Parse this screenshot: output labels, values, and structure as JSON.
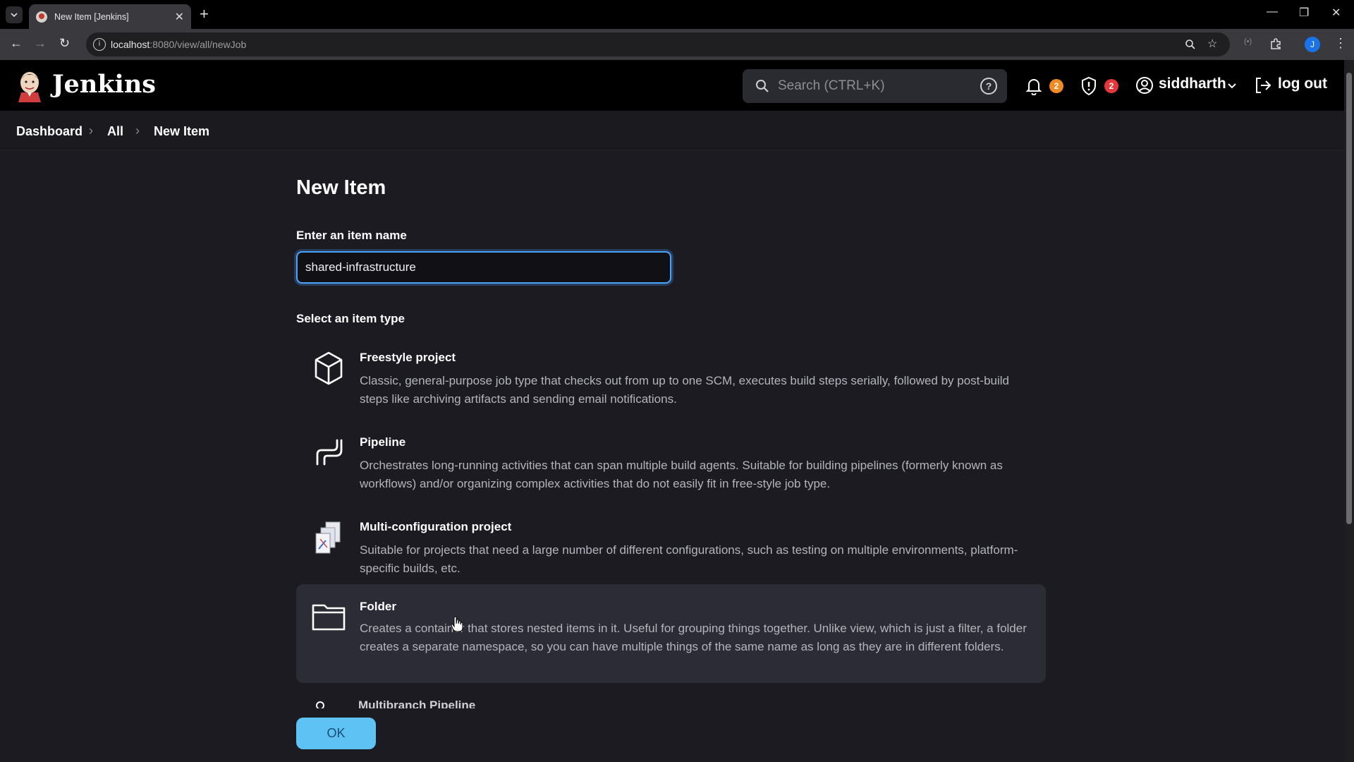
{
  "browser": {
    "tab_title": "New Item [Jenkins]",
    "url_host": "localhost",
    "url_rest": ":8080/view/all/newJob",
    "profile_initial": "J"
  },
  "header": {
    "brand": "Jenkins",
    "search_placeholder": "Search (CTRL+K)",
    "notifications_count": "2",
    "security_count": "2",
    "user": "siddharth",
    "logout": "log out",
    "colors": {
      "notify_badge": "#f08a24",
      "security_badge": "#e5383b"
    }
  },
  "breadcrumb": [
    "Dashboard",
    "All",
    "New Item"
  ],
  "page": {
    "title": "New Item",
    "name_label": "Enter an item name",
    "name_value": "shared-infrastructure",
    "type_label": "Select an item type",
    "ok_label": "OK"
  },
  "item_types": [
    {
      "name": "Freestyle project",
      "icon": "cube-icon",
      "description": "Classic, general-purpose job type that checks out from up to one SCM, executes build steps serially, followed by post-build steps like archiving artifacts and sending email notifications."
    },
    {
      "name": "Pipeline",
      "icon": "pipeline-icon",
      "description": "Orchestrates long-running activities that can span multiple build agents. Suitable for building pipelines (formerly known as workflows) and/or organizing complex activities that do not easily fit in free-style job type."
    },
    {
      "name": "Multi-configuration project",
      "icon": "documents-icon",
      "description": "Suitable for projects that need a large number of different configurations, such as testing on multiple environments, platform-specific builds, etc."
    },
    {
      "name": "Folder",
      "icon": "folder-icon",
      "description": "Creates a container that stores nested items in it. Useful for grouping things together. Unlike view, which is just a filter, a folder creates a separate namespace, so you can have multiple things of the same name as long as they are in different folders."
    },
    {
      "name": "Multibranch Pipeline",
      "icon": "multibranch-icon"
    }
  ]
}
